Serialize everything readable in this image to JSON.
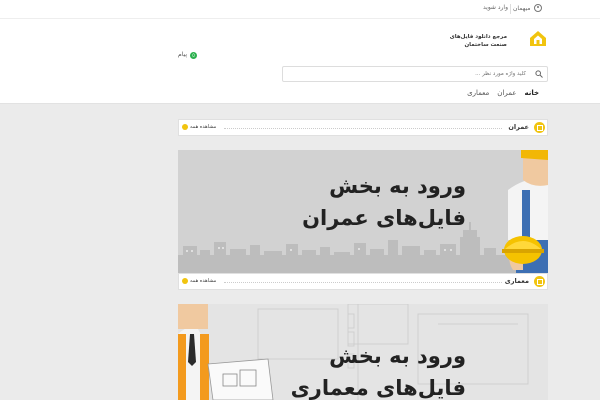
{
  "top": {
    "user_label": "میهمان",
    "login_label": "وارد شوید"
  },
  "logo": {
    "line1": "مرجع دانلود فایل‌های",
    "line2": "صنعت ساختمان"
  },
  "search": {
    "placeholder": "کلید واژه مورد نظر ..."
  },
  "cart": {
    "label": "پیام",
    "count": "0"
  },
  "nav": {
    "items": [
      "خانه",
      "عمران",
      "معماری"
    ]
  },
  "sections": [
    {
      "title": "عمران",
      "more": "مشاهده همه",
      "banner_line1": "ورود به بخش",
      "banner_line2": "فایل‌های عمران"
    },
    {
      "title": "معماری",
      "more": "مشاهده همه",
      "banner_line1": "ورود به بخش",
      "banner_line2": "فایل‌های معماری"
    }
  ],
  "colors": {
    "accent": "#f1c40f",
    "badge": "#2bb14e",
    "banner1_bg": "#d2d2d2",
    "banner2_bg": "#e4e4e4"
  }
}
